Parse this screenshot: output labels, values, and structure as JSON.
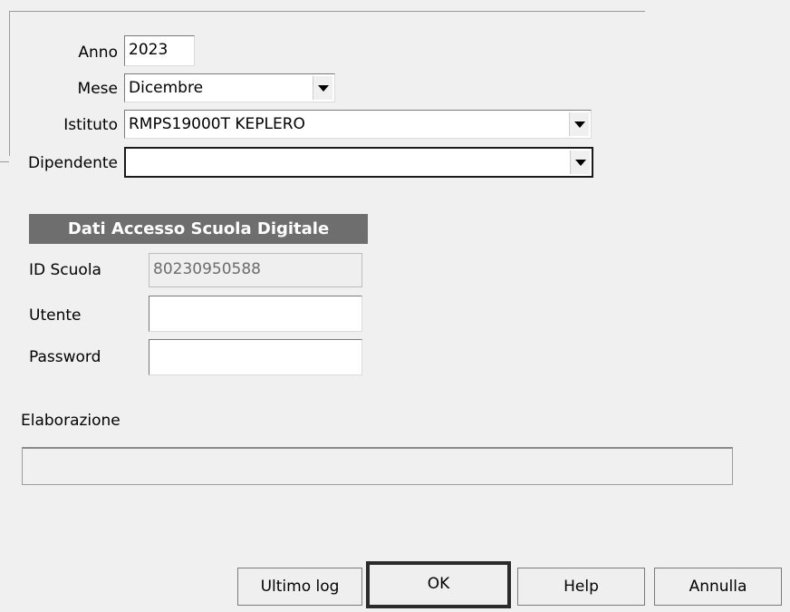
{
  "form": {
    "anno": {
      "label": "Anno",
      "value": "2023"
    },
    "mese": {
      "label": "Mese",
      "value": "Dicembre"
    },
    "istituto": {
      "label": "Istituto",
      "value": "RMPS19000T KEPLERO"
    },
    "dipendente": {
      "label": "Dipendente",
      "value": ""
    }
  },
  "access": {
    "title": "Dati Accesso Scuola Digitale",
    "id_scuola": {
      "label": "ID Scuola",
      "value": "80230950588"
    },
    "utente": {
      "label": "Utente",
      "value": ""
    },
    "password": {
      "label": "Password",
      "value": ""
    }
  },
  "elaborazione": {
    "label": "Elaborazione"
  },
  "buttons": {
    "ultimo_log": "Ultimo log",
    "ok": "OK",
    "help": "Help",
    "annulla": "Annulla"
  }
}
